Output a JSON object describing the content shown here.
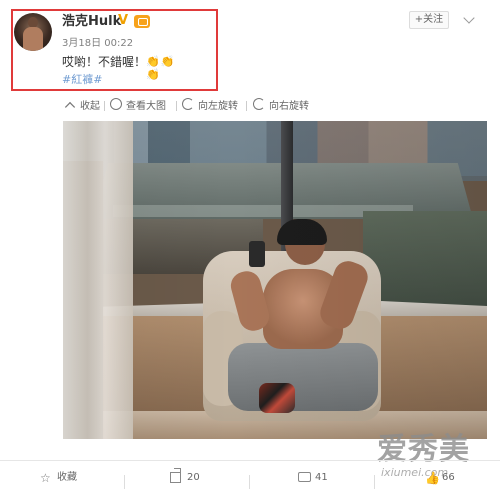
{
  "header": {
    "username": "浩克Hulk",
    "verified_mark": "V",
    "timestamp": "3月18日 00:22",
    "text": "哎喲！不錯喔！",
    "emoji_text": "👏👏👏",
    "hashtag": "#紅褲#",
    "follow_label": "+关注",
    "icons": {
      "avatar": "user-avatar",
      "verified": "verified-badge-icon",
      "vip": "vip-badge-icon",
      "menu": "chevron-down-icon"
    },
    "colors": {
      "highlight_border": "#e03a3a",
      "hashtag": "#6f9bd1",
      "verified": "#f0a000"
    }
  },
  "toolbar": {
    "items": [
      {
        "label": "收起",
        "icon": "collapse-icon"
      },
      {
        "label": "查看大图",
        "icon": "search-icon"
      },
      {
        "label": "向左旋转",
        "icon": "rotate-left-icon"
      },
      {
        "label": "向右旋转",
        "icon": "rotate-right-icon"
      }
    ]
  },
  "watermark": {
    "main": "爱秀美",
    "url": "ixiumei.com"
  },
  "actions": {
    "favorite": {
      "label": "收藏",
      "icon": "star-icon"
    },
    "share": {
      "count": "20",
      "icon": "share-icon"
    },
    "comment": {
      "count": "41",
      "icon": "comment-icon"
    },
    "like": {
      "count": "66",
      "icon": "like-icon"
    }
  }
}
